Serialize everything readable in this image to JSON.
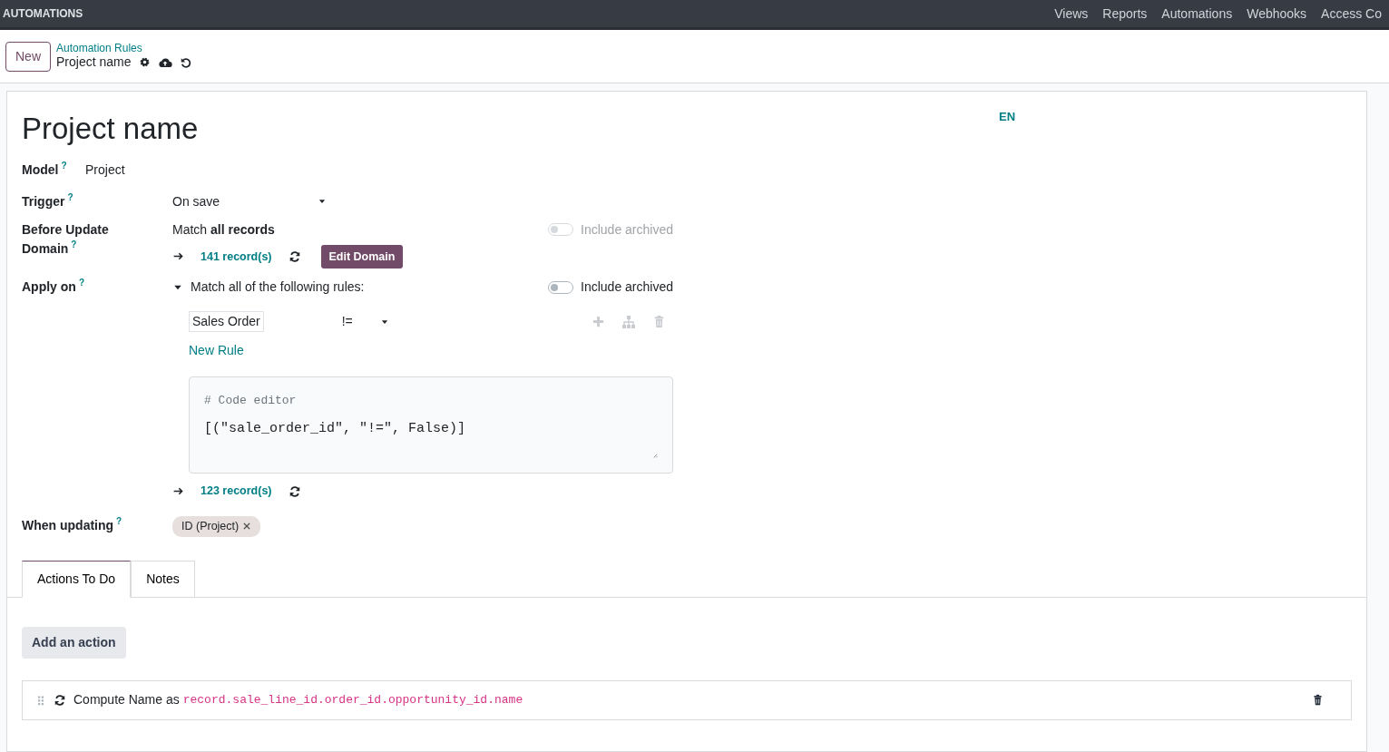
{
  "topbar": {
    "app_title": "AUTOMATIONS",
    "menu": [
      "Views",
      "Reports",
      "Automations",
      "Webhooks",
      "Access Co"
    ]
  },
  "control_panel": {
    "new_button": "New",
    "breadcrumb_parent": "Automation Rules",
    "breadcrumb_current": "Project name"
  },
  "form": {
    "title": "Project name",
    "language": "EN",
    "model": {
      "label": "Model",
      "help": "?",
      "value": "Project"
    },
    "trigger": {
      "label": "Trigger",
      "help": "?",
      "value": "On save"
    },
    "before_update_domain": {
      "label": "Before Update Domain",
      "help": "?",
      "match_text": "Match **all records**",
      "include_archived": {
        "label": "Include archived",
        "on": false,
        "disabled": true
      },
      "record_count": "141 record(s)",
      "edit_button": "Edit Domain"
    },
    "apply_on": {
      "label": "Apply on",
      "help": "?",
      "expanded": true,
      "match_text": "Match all of the following rules:",
      "include_archived": {
        "label": "Include archived",
        "on": false,
        "disabled": false
      },
      "rules": [
        {
          "field": "Sales Order",
          "operator": "!="
        }
      ],
      "new_rule": "New Rule",
      "code_comment": "# Code editor",
      "code": "[(\"sale_order_id\", \"!=\", False)]",
      "record_count": "123 record(s)"
    },
    "when_updating": {
      "label": "When updating",
      "help": "?",
      "tags": [
        "ID (Project)"
      ]
    },
    "tabs": [
      {
        "label": "Actions To Do",
        "selected": true
      },
      {
        "label": "Notes",
        "selected": false
      }
    ],
    "add_action_button": "Add an action",
    "actions": [
      {
        "prefix": "Compute Name as",
        "expression": "record.sale_line_id.order_id.opportunity_id.name"
      }
    ]
  }
}
